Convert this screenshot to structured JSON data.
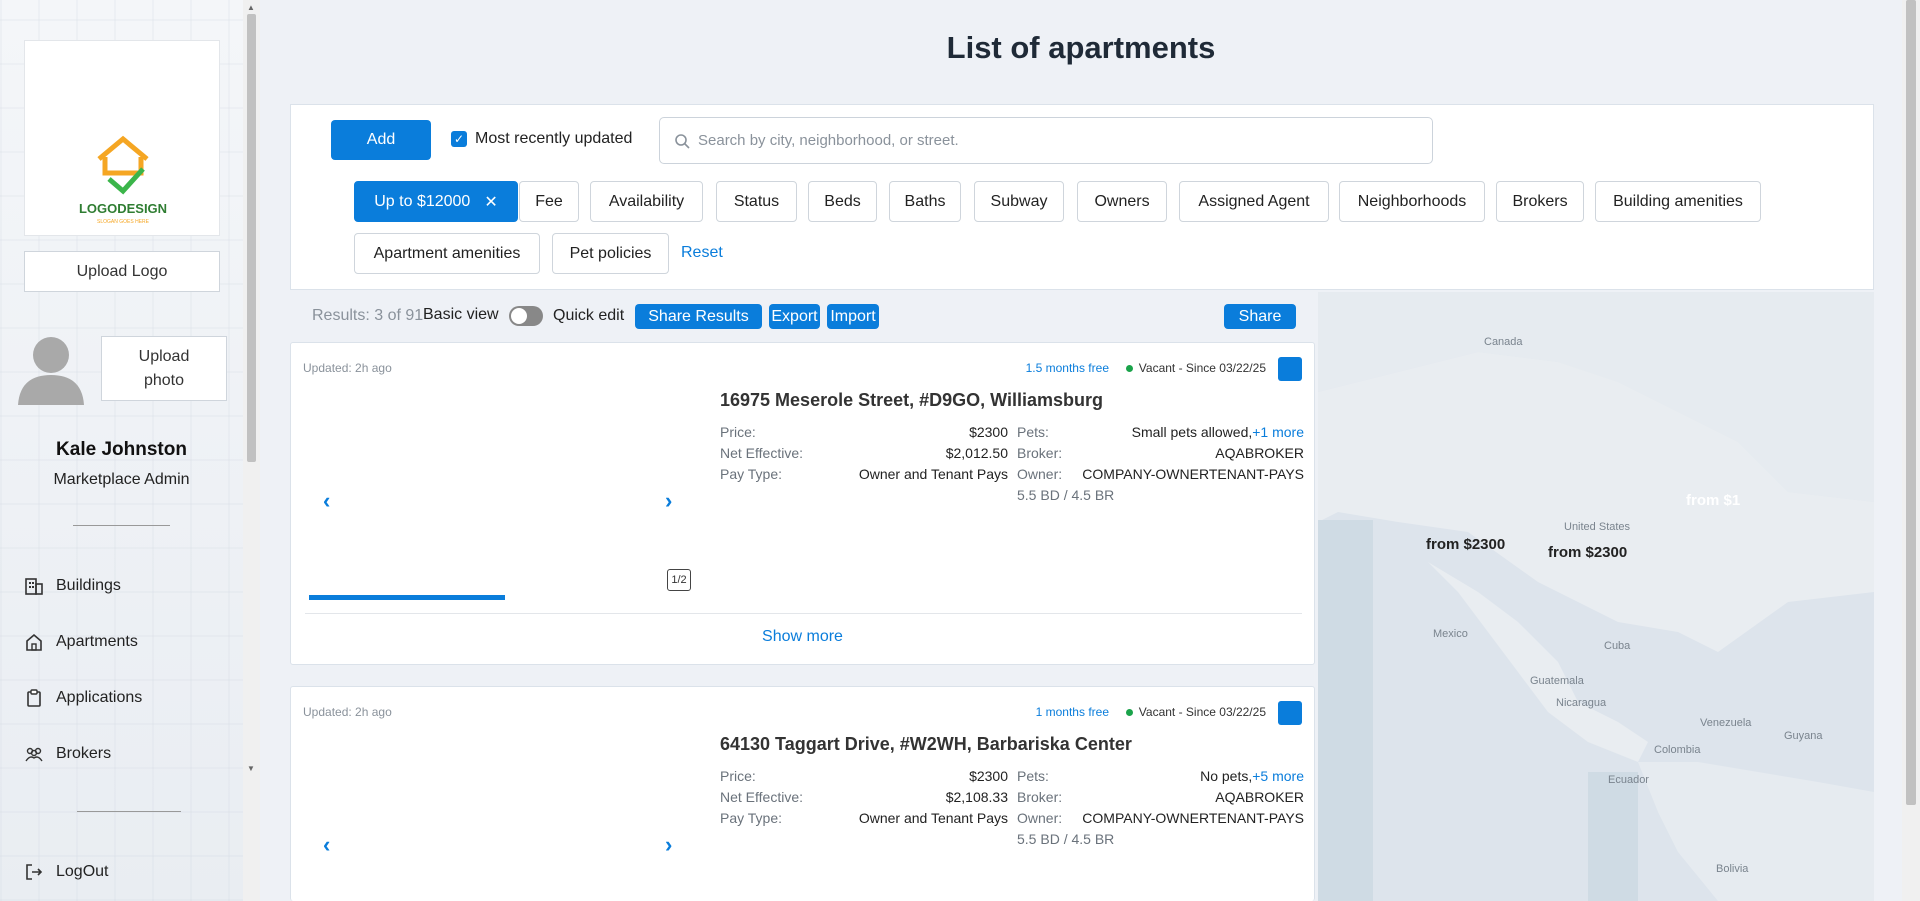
{
  "sidebar": {
    "upload_logo": "Upload Logo",
    "upload_photo": "Upload photo",
    "user_name": "Kale Johnston",
    "user_role": "Marketplace Admin",
    "logo_text": "LOGODESIGN",
    "nav": [
      {
        "label": "Buildings",
        "icon": "building-icon"
      },
      {
        "label": "Apartments",
        "icon": "home-icon"
      },
      {
        "label": "Applications",
        "icon": "clipboard-icon"
      },
      {
        "label": "Brokers",
        "icon": "people-icon"
      }
    ],
    "logout": "LogOut"
  },
  "header": {
    "title": "List of apartments"
  },
  "filters": {
    "add_label": "Add",
    "most_recent_label": "Most recently updated",
    "most_recent_checked": true,
    "search_placeholder": "Search by city, neighborhood, or street.",
    "active_chip": "Up to $12000",
    "chips": [
      "Fee",
      "Availability",
      "Status",
      "Beds",
      "Baths",
      "Subway",
      "Owners",
      "Assigned Agent",
      "Neighborhoods",
      "Brokers",
      "Building amenities"
    ],
    "chips_row2": [
      "Apartment amenities",
      "Pet policies"
    ],
    "reset": "Reset"
  },
  "toolbar": {
    "results": "Results: 3 of 91",
    "basic_view": "Basic view",
    "quick_edit": "Quick edit",
    "share_results": "Share Results",
    "export": "Export",
    "import": "Import",
    "share": "Share"
  },
  "listings": [
    {
      "updated": "Updated: 2h ago",
      "free": "1.5 months free",
      "status": "Vacant - Since 03/22/25",
      "title": "16975 Meserole Street, #D9GO, Williamsburg",
      "price_label": "Price:",
      "price": "$2300",
      "net_label": "Net Effective:",
      "net": "$2,012.50",
      "pay_label": "Pay Type:",
      "pay": "Owner and Tenant Pays",
      "pets_label": "Pets:",
      "pets": "Small pets allowed,",
      "pets_more": "+1 more",
      "broker_label": "Broker:",
      "broker": "AQABROKER",
      "owner_label": "Owner:",
      "owner": "COMPANY-OWNERTENANT-PAYS",
      "bdbr": "5.5 BD / 4.5 BR",
      "pager": "1/2",
      "show_more": "Show more"
    },
    {
      "updated": "Updated: 2h ago",
      "free": "1 months free",
      "status": "Vacant - Since 03/22/25",
      "title": "64130 Taggart Drive, #W2WH, Barbariska Center",
      "price_label": "Price:",
      "price": "$2300",
      "net_label": "Net Effective:",
      "net": "$2,108.33",
      "pay_label": "Pay Type:",
      "pay": "Owner and Tenant Pays",
      "pets_label": "Pets:",
      "pets": "No pets,",
      "pets_more": "+5 more",
      "broker_label": "Broker:",
      "broker": "AQABROKER",
      "owner_label": "Owner:",
      "owner": "COMPANY-OWNERTENANT-PAYS",
      "bdbr": "5.5 BD / 4.5 BR"
    }
  ],
  "map": {
    "labels": [
      "from $2300",
      "from $2300",
      "from $1"
    ],
    "places": [
      "Canada",
      "United States",
      "Mexico",
      "Cuba",
      "Guatemala",
      "Nicaragua",
      "Venezuela",
      "Colombia",
      "Ecuador",
      "Bolivia",
      "Guyana"
    ]
  },
  "colors": {
    "accent": "#0a7ddb",
    "vacant": "#1aa34a"
  }
}
